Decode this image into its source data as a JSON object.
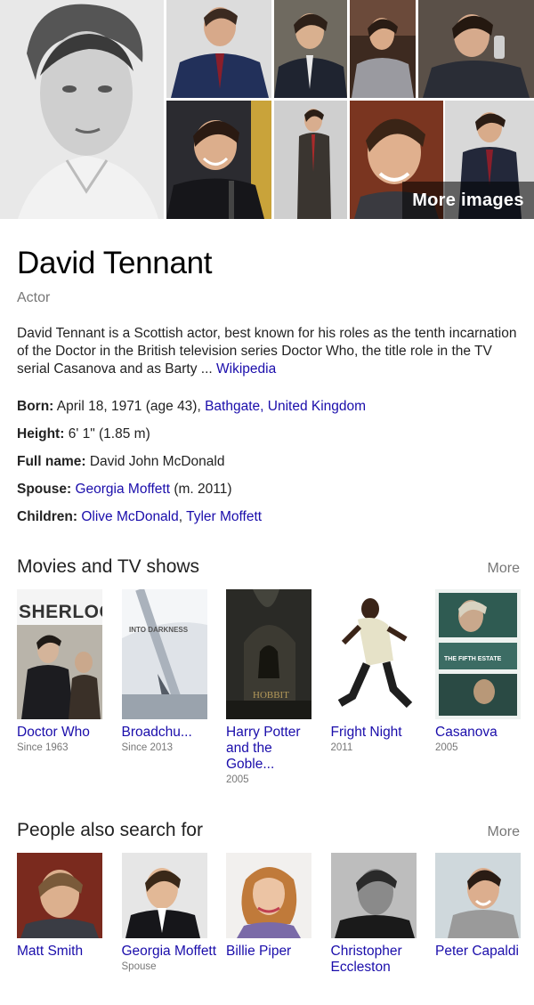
{
  "images": {
    "more_images_label": "More images"
  },
  "entity": {
    "name": "David Tennant",
    "type": "Actor",
    "description": "David Tennant is a Scottish actor, best known for his roles as the tenth incarnation of the Doctor in the British television series Doctor Who, the title role in the TV serial Casanova and as Barty ... ",
    "source_link": "Wikipedia"
  },
  "facts": {
    "born": {
      "label": "Born:",
      "text": "April 18, 1971 (age 43), ",
      "link": "Bathgate, United Kingdom"
    },
    "height": {
      "label": "Height:",
      "text": "6' 1\" (1.85 m)"
    },
    "full_name": {
      "label": "Full name:",
      "text": "David John McDonald"
    },
    "spouse": {
      "label": "Spouse:",
      "link": "Georgia Moffett",
      "text": " (m. 2011)"
    },
    "children": {
      "label": "Children:",
      "link1": "Olive McDonald",
      "sep": ", ",
      "link2": "Tyler Moffett"
    }
  },
  "movies": {
    "title": "Movies and TV shows",
    "more_label": "More",
    "items": [
      {
        "name": "Doctor Who",
        "sub": "Since 1963",
        "poster_text": "SHERLOC"
      },
      {
        "name": "Broadchu...",
        "sub": "Since 2013",
        "poster_text": "INTO DARKNESS"
      },
      {
        "name": "Harry Potter and the Goble...",
        "sub": "2005",
        "poster_text": "HOBBIT"
      },
      {
        "name": "Fright Night",
        "sub": "2011",
        "poster_text": ""
      },
      {
        "name": "Casanova",
        "sub": "2005",
        "poster_text": "THE FIFTH ESTATE"
      }
    ]
  },
  "people": {
    "title": "People also search for",
    "more_label": "More",
    "items": [
      {
        "name": "Matt Smith",
        "sub": ""
      },
      {
        "name": "Georgia Moffett",
        "sub": "Spouse"
      },
      {
        "name": "Billie Piper",
        "sub": ""
      },
      {
        "name": "Christopher Eccleston",
        "sub": ""
      },
      {
        "name": "Peter Capaldi",
        "sub": ""
      }
    ]
  }
}
